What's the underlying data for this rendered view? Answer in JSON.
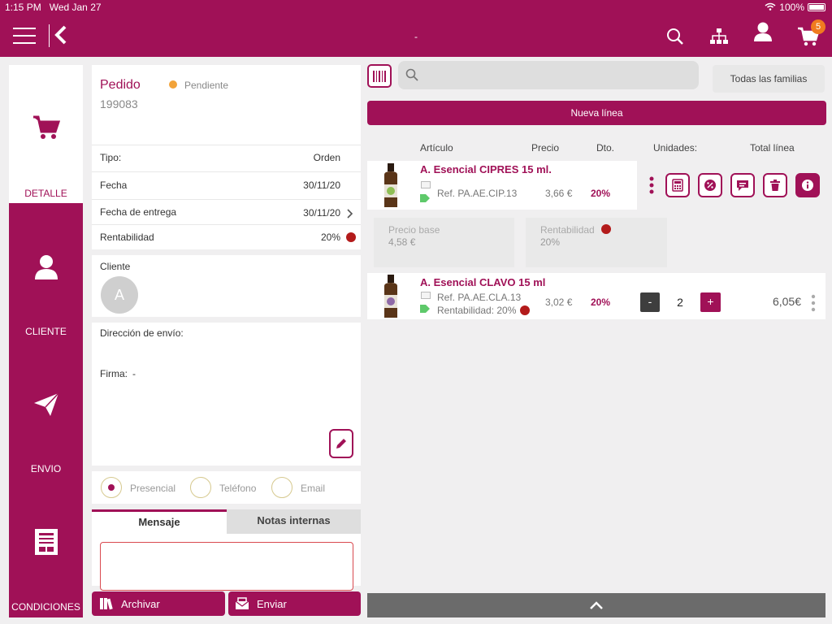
{
  "status_bar": {
    "time": "1:15 PM",
    "date": "Wed Jan 27",
    "battery": "100%"
  },
  "header": {
    "title": "-",
    "cart_count": "5"
  },
  "nav": [
    {
      "label": "DETALLE",
      "icon": "cart-icon"
    },
    {
      "label": "CLIENTE",
      "icon": "user-icon"
    },
    {
      "label": "ENVIO",
      "icon": "send-icon"
    },
    {
      "label": "CONDICIONES",
      "icon": "document-icon"
    }
  ],
  "order": {
    "title": "Pedido",
    "status": "Pendiente",
    "number": "199083",
    "fields": [
      {
        "label": "Tipo:",
        "value": "Orden"
      },
      {
        "label": "Fecha",
        "value": "30/11/20"
      },
      {
        "label": "Fecha de entrega",
        "value": "30/11/20"
      },
      {
        "label": "Rentabilidad",
        "value": "20%"
      }
    ],
    "client_label": "Cliente",
    "avatar_letter": "A",
    "shipping_label": "Dirección de envío:",
    "signature_label": "Firma:",
    "signature_value": "-"
  },
  "contact_modes": [
    "Presencial",
    "Teléfono",
    "Email"
  ],
  "tabs": [
    "Mensaje",
    "Notas internas"
  ],
  "buttons": {
    "archive": "Archivar",
    "send": "Enviar"
  },
  "toolbar": {
    "families": "Todas las familias",
    "new_line": "Nueva línea"
  },
  "columns": [
    "Artículo",
    "Precio",
    "Dto.",
    "Unidades:",
    "Total línea"
  ],
  "lines": [
    {
      "name": "A. Esencial CIPRES 15 ml.",
      "ref": "Ref. PA.AE.CIP.13",
      "price": "3,66 €",
      "discount": "20%",
      "base_price_label": "Precio base",
      "base_price": "4,58 €",
      "profit_label": "Rentabilidad",
      "profit": "20%"
    },
    {
      "name": "A. Esencial CLAVO 15 ml",
      "ref": "Ref. PA.AE.CLA.13",
      "profit_text": "Rentabilidad: 20%",
      "price": "3,02 €",
      "discount": "20%",
      "qty": "2",
      "minus": "-",
      "plus": "+",
      "total": "6,05€"
    }
  ],
  "colors": {
    "brand": "#a01157",
    "badge": "#f07b1f",
    "status": "#f2a33a"
  }
}
